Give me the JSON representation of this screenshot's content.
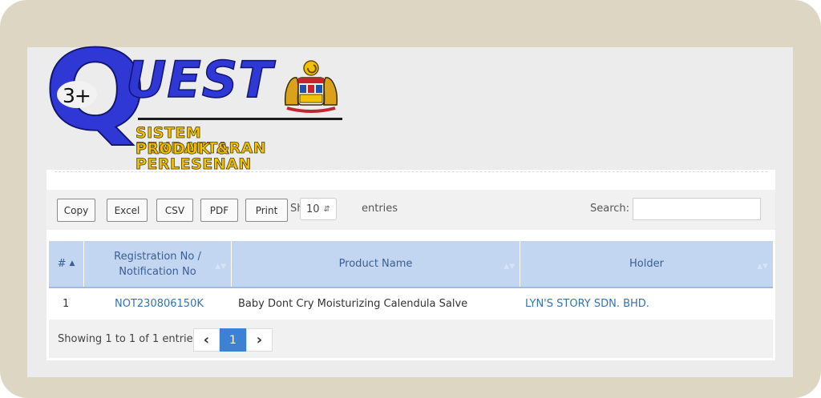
{
  "logo": {
    "three_plus": "3+",
    "uest": "UEST",
    "line1": "SISTEM PENDAFTARAN",
    "line2": "PRODUK & PERLESENAN"
  },
  "toolbar": {
    "buttons": [
      "Copy",
      "Excel",
      "CSV",
      "PDF",
      "Print"
    ],
    "show_label": "Show",
    "page_size": "10",
    "entries_label": "entries",
    "search_label": "Search:",
    "search_value": ""
  },
  "table": {
    "columns": [
      "#",
      "Registration No / Notification No",
      "Product Name",
      "Holder"
    ],
    "rows": [
      [
        "1",
        "NOT230806150K",
        "Baby Dont Cry Moisturizing Calendula Salve",
        "LYN'S STORY SDN. BHD."
      ]
    ]
  },
  "footer": {
    "info": "Showing 1 to 1 of 1 entries",
    "prev": "‹",
    "current_page": "1",
    "next": "›"
  },
  "colors": {
    "frame": "#dcd6c3",
    "header": "#c2d5f1",
    "link": "#3372b3",
    "active_page": "#3e80d3",
    "logo_blue": "#2f37d4",
    "logo_yellow": "#f2c200"
  }
}
